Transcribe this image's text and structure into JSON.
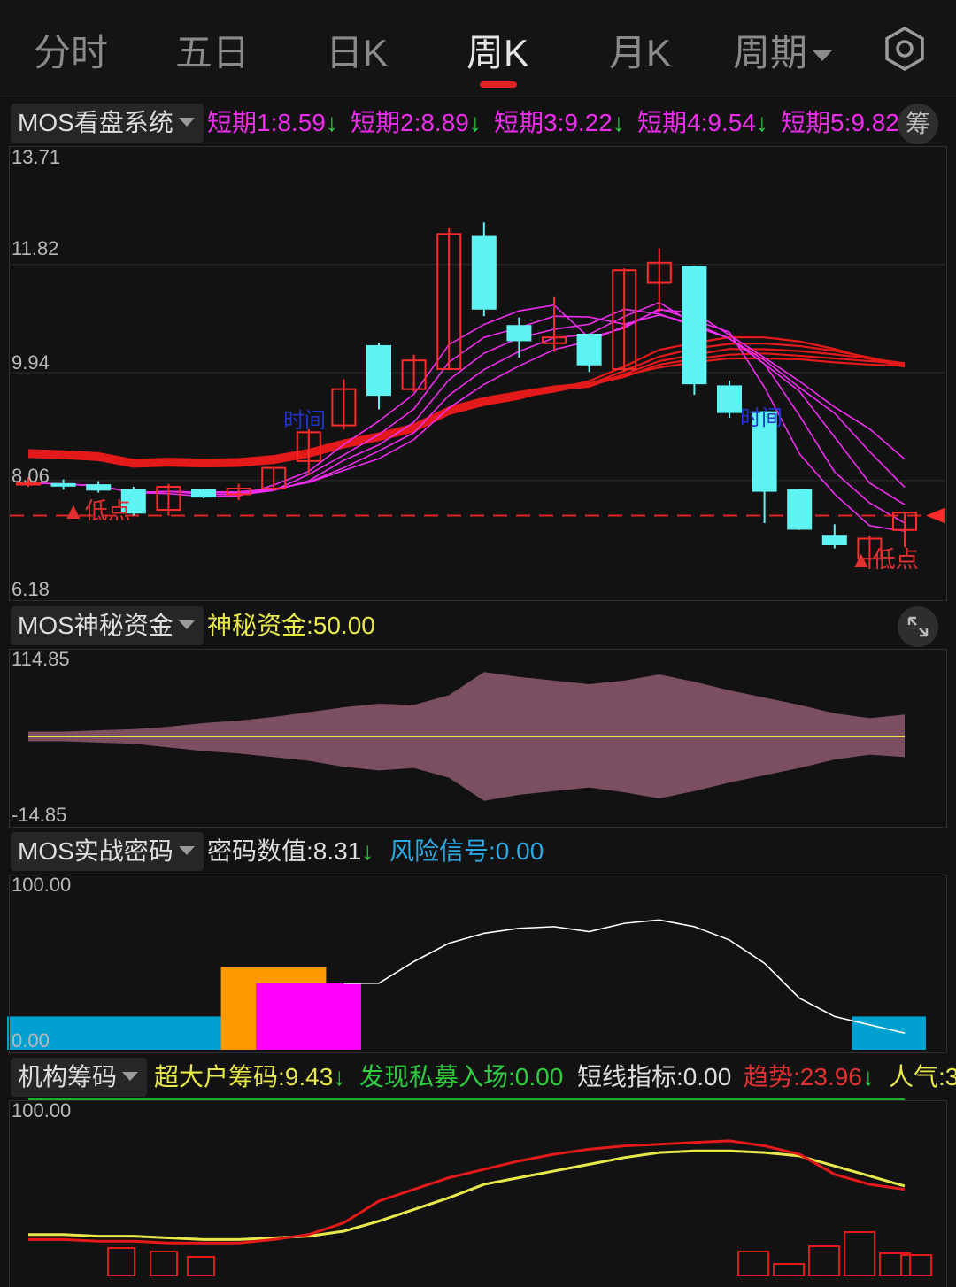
{
  "tabs": [
    {
      "label": "分时"
    },
    {
      "label": "五日"
    },
    {
      "label": "日K"
    },
    {
      "label": "周K"
    },
    {
      "label": "月K"
    },
    {
      "label": "周期"
    }
  ],
  "active_tab": "周K",
  "colors": {
    "up": "#ff2a2a",
    "down": "#5ff4f4",
    "accent": "#e02222",
    "purple": "#ee2cee",
    "yellow": "#e8e84a"
  },
  "main": {
    "selector": "MOS看盘系统",
    "metrics": [
      {
        "label": "短期1:",
        "value": "8.59"
      },
      {
        "label": "短期2:",
        "value": "8.89"
      },
      {
        "label": "短期3:",
        "value": "9.22"
      },
      {
        "label": "短期4:",
        "value": "9.54"
      },
      {
        "label": "短期5:",
        "value": "9.82"
      }
    ],
    "chip_button": "筹",
    "y_labels": [
      "13.71",
      "11.82",
      "9.94",
      "8.06",
      "6.18"
    ],
    "annotations": [
      "▲低点",
      "▲低点",
      "时间",
      "时间"
    ]
  },
  "secret": {
    "selector": "MOS神秘资金",
    "metric_label": "神秘资金:",
    "metric_value": "50.00",
    "y_labels": [
      "114.85",
      "-14.85"
    ]
  },
  "code": {
    "selector": "MOS实战密码",
    "m1_label": "密码数值:",
    "m1_value": "8.31",
    "m2_label": "风险信号:",
    "m2_value": "0.00",
    "y_labels": [
      "100.00",
      "0.00"
    ]
  },
  "inst": {
    "selector": "机构筹码",
    "m1_label": "超大户筹码:",
    "m1_value": "9.43",
    "m2_label": "发现私募入场:",
    "m2_value": "0.00",
    "m3_label": "短线指标:",
    "m3_value": "0.00",
    "m4_label": "趋势:",
    "m4_value": "23.96",
    "m5_label": "人气:3",
    "y_labels": [
      "100.00"
    ]
  },
  "chart_data": {
    "type": "candlestick",
    "y_range": [
      6.18,
      13.71
    ],
    "ohlc": [
      [
        8.02,
        8.12,
        7.95,
        8.02
      ],
      [
        8.0,
        8.08,
        7.9,
        7.98
      ],
      [
        7.98,
        8.05,
        7.85,
        7.9
      ],
      [
        7.9,
        7.95,
        7.45,
        7.5
      ],
      [
        7.55,
        8.0,
        7.45,
        7.95
      ],
      [
        7.9,
        7.92,
        7.75,
        7.78
      ],
      [
        7.82,
        8.0,
        7.72,
        7.92
      ],
      [
        7.92,
        8.3,
        7.88,
        8.28
      ],
      [
        8.4,
        8.95,
        8.15,
        8.9
      ],
      [
        9.02,
        9.82,
        8.95,
        9.65
      ],
      [
        10.4,
        10.45,
        9.3,
        9.55
      ],
      [
        9.65,
        10.25,
        9.6,
        10.15
      ],
      [
        10.0,
        12.45,
        9.98,
        12.35
      ],
      [
        12.3,
        12.55,
        10.92,
        11.05
      ],
      [
        10.75,
        10.9,
        10.2,
        10.5
      ],
      [
        10.45,
        11.25,
        10.3,
        10.55
      ],
      [
        10.6,
        10.62,
        9.95,
        10.08
      ],
      [
        10.0,
        11.75,
        9.95,
        11.72
      ],
      [
        11.5,
        12.1,
        11.0,
        11.85
      ],
      [
        11.78,
        11.8,
        9.55,
        9.75
      ],
      [
        9.7,
        9.8,
        9.15,
        9.25
      ],
      [
        9.25,
        9.25,
        7.32,
        7.88
      ],
      [
        7.9,
        7.92,
        7.2,
        7.22
      ],
      [
        7.1,
        7.3,
        6.88,
        6.95
      ],
      [
        6.7,
        7.1,
        6.52,
        7.05
      ],
      [
        7.2,
        7.5,
        6.9,
        7.5
      ]
    ],
    "support_line": 7.45,
    "secret_fund": {
      "y_range": [
        -14.85,
        114.85
      ],
      "center": 50.0,
      "upper": [
        54,
        54,
        55,
        56,
        58,
        61,
        63,
        66,
        70,
        74,
        77,
        76,
        84,
        103,
        99,
        96,
        93,
        96,
        101,
        95,
        88,
        82,
        76,
        69,
        65,
        68
      ],
      "lower": [
        46,
        46,
        45,
        44,
        41,
        38,
        36,
        33,
        30,
        25,
        22,
        24,
        16,
        -3,
        2,
        5,
        8,
        4,
        -1,
        5,
        12,
        18,
        24,
        31,
        35,
        33
      ]
    },
    "code_line": {
      "y_range": [
        0,
        100
      ],
      "values": [
        null,
        null,
        null,
        null,
        null,
        null,
        null,
        null,
        null,
        40,
        40,
        53,
        64,
        70,
        73,
        74,
        71,
        76,
        78,
        74,
        66,
        52,
        31,
        20,
        15,
        10
      ]
    },
    "code_bars": [
      {
        "color": "#00a0d0",
        "start": 0,
        "end": 6,
        "height": 20
      },
      {
        "color": "#ff9900",
        "start": 6,
        "end": 9,
        "height": 50
      },
      {
        "color": "#ff00ff",
        "start": 7,
        "end": 10,
        "height": 40
      },
      {
        "color": "#00a0d0",
        "start": 24,
        "end": 26,
        "height": 20
      }
    ],
    "inst_red": [
      22,
      22,
      21,
      21,
      20,
      20,
      20,
      22,
      25,
      32,
      45,
      52,
      59,
      64,
      69,
      73,
      76,
      78,
      79,
      80,
      81,
      78,
      73,
      61,
      55,
      52
    ],
    "inst_yellow": [
      25,
      25,
      24,
      24,
      23,
      22,
      22,
      23,
      24,
      27,
      33,
      40,
      47,
      55,
      59,
      63,
      67,
      71,
      74,
      75,
      75,
      74,
      72,
      66,
      60,
      54
    ]
  }
}
